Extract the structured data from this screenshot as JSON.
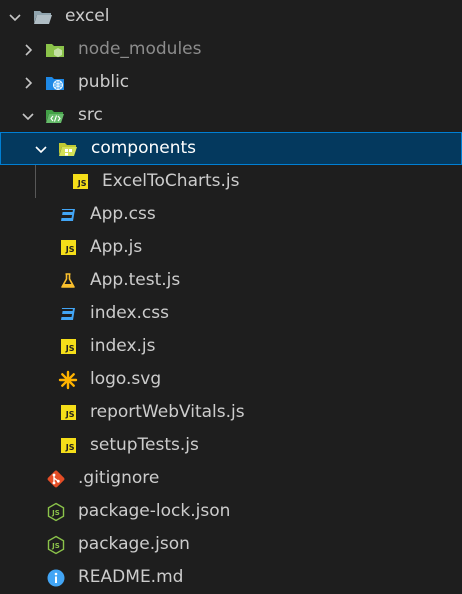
{
  "explorer": {
    "items": [
      {
        "label": "excel",
        "kind": "folder-open",
        "icon": "folder-icon"
      },
      {
        "label": "node_modules",
        "kind": "folder-collapsed",
        "icon": "node-folder-icon"
      },
      {
        "label": "public",
        "kind": "folder-collapsed",
        "icon": "public-folder-icon"
      },
      {
        "label": "src",
        "kind": "folder-open",
        "icon": "src-folder-icon"
      },
      {
        "label": "components",
        "kind": "folder-open",
        "icon": "components-folder-icon",
        "selected": true
      },
      {
        "label": "ExcelToCharts.js",
        "kind": "file",
        "icon": "js-file-icon"
      },
      {
        "label": "App.css",
        "kind": "file",
        "icon": "css-file-icon"
      },
      {
        "label": "App.js",
        "kind": "file",
        "icon": "js-file-icon"
      },
      {
        "label": "App.test.js",
        "kind": "file",
        "icon": "test-flask-icon"
      },
      {
        "label": "index.css",
        "kind": "file",
        "icon": "css-file-icon"
      },
      {
        "label": "index.js",
        "kind": "file",
        "icon": "js-file-icon"
      },
      {
        "label": "logo.svg",
        "kind": "file",
        "icon": "svg-file-icon"
      },
      {
        "label": "reportWebVitals.js",
        "kind": "file",
        "icon": "js-file-icon"
      },
      {
        "label": "setupTests.js",
        "kind": "file",
        "icon": "js-file-icon"
      },
      {
        "label": ".gitignore",
        "kind": "file",
        "icon": "git-icon"
      },
      {
        "label": "package-lock.json",
        "kind": "file",
        "icon": "node-json-icon"
      },
      {
        "label": "package.json",
        "kind": "file",
        "icon": "node-json-icon"
      },
      {
        "label": "README.md",
        "kind": "file",
        "icon": "info-icon"
      }
    ],
    "js_badge_text": "JS",
    "colors": {
      "background": "#1e1e1e",
      "selection": "#04395e",
      "selection_border": "#007fd4",
      "text": "#cccccc",
      "dimmed_text": "#8c8c8c",
      "js_yellow": "#f5de19",
      "css_blue": "#42a5f5",
      "git_orange": "#e44d26",
      "node_green": "#8bc34a"
    }
  }
}
